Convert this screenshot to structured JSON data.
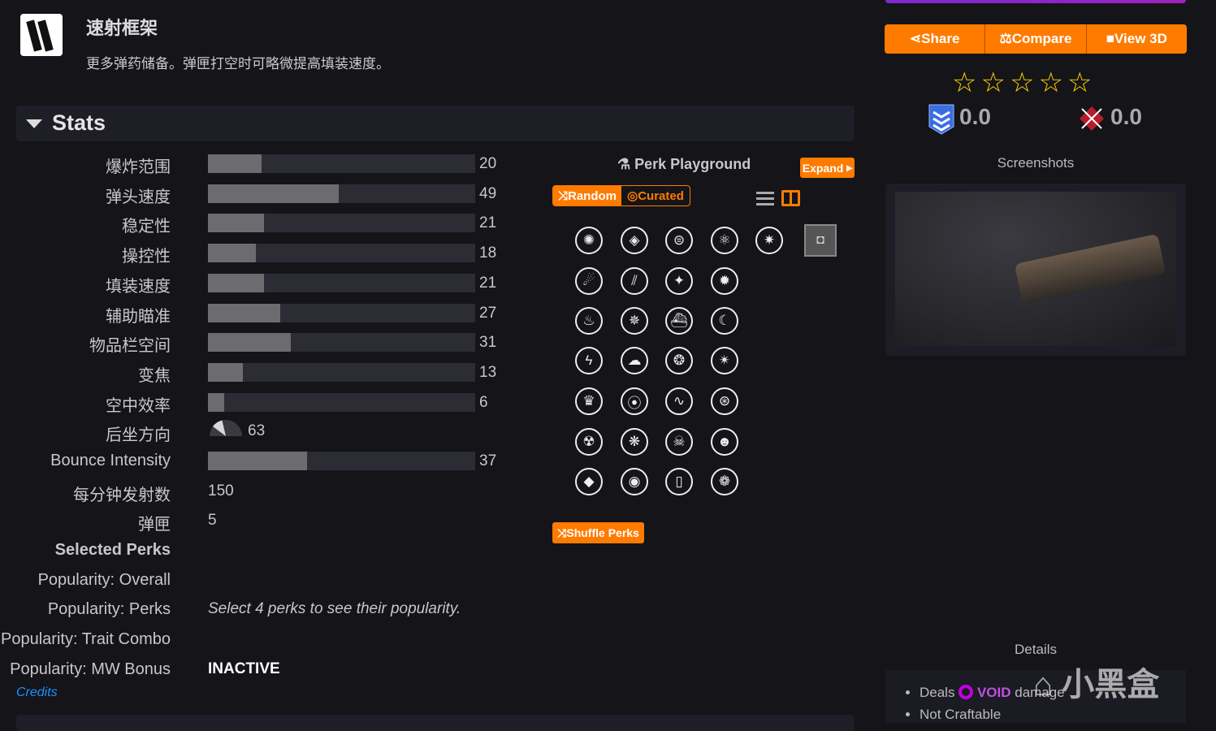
{
  "perk": {
    "title": "速射框架",
    "description": "更多弹药储备。弹匣打空时可略微提高填装速度。"
  },
  "stats_header": "Stats",
  "stats": [
    {
      "label": "爆炸范围",
      "value": 20
    },
    {
      "label": "弹头速度",
      "value": 49
    },
    {
      "label": "稳定性",
      "value": 21
    },
    {
      "label": "操控性",
      "value": 18
    },
    {
      "label": "填装速度",
      "value": 21
    },
    {
      "label": "辅助瞄准",
      "value": 27
    },
    {
      "label": "物品栏空间",
      "value": 31
    },
    {
      "label": "变焦",
      "value": 13
    },
    {
      "label": "空中效率",
      "value": 6
    }
  ],
  "recoil": {
    "label": "后坐方向",
    "value": 63
  },
  "bounce": {
    "label": "Bounce Intensity",
    "value": 37
  },
  "rpm": {
    "label": "每分钟发射数",
    "value": "150"
  },
  "magazine": {
    "label": "弹匣",
    "value": "5"
  },
  "selected_perks": "Selected Perks",
  "popularity": {
    "overall": "Popularity: Overall",
    "perks": "Popularity: Perks",
    "perks_note": "Select 4 perks to see their popularity.",
    "trait": "Popularity: Trait Combo",
    "mw": "Popularity: MW Bonus",
    "mw_value": "INACTIVE"
  },
  "credits": "Credits",
  "playground": {
    "title": "Perk Playground",
    "expand": "Expand",
    "random": "Random",
    "curated": "Curated",
    "shuffle": "Shuffle Perks",
    "mode": "Random"
  },
  "actions": {
    "share": "Share",
    "compare": "Compare",
    "view3d": "View 3D"
  },
  "rating": {
    "stars": 0,
    "max": 5,
    "pve": "0.0",
    "pvp": "0.0"
  },
  "screenshots_label": "Screenshots",
  "details": {
    "label": "Details",
    "deals": "Deals",
    "element": "VOID",
    "damage": "damage",
    "craftable": "Not Craftable"
  },
  "watermark": "小黑盒",
  "colors": {
    "accent": "#ff7b00",
    "void": "#c000e0",
    "star": "#ffd400",
    "link": "#1e90ff"
  }
}
